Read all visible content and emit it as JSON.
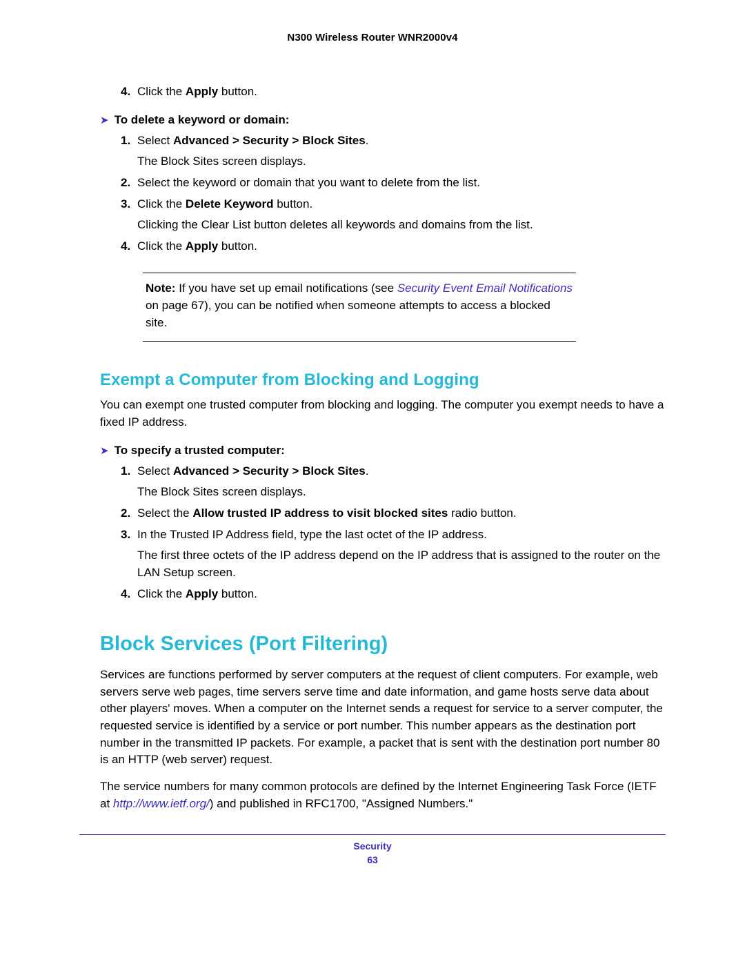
{
  "header": {
    "title": "N300 Wireless Router WNR2000v4"
  },
  "intro_step": {
    "num": "4.",
    "pre": "Click the ",
    "bold": "Apply",
    "post": " button."
  },
  "delete_proc": {
    "arrow": "➤",
    "label": "To delete a keyword or domain:",
    "steps": [
      {
        "num": "1.",
        "pre": "Select ",
        "bold": "Advanced > Security > Block Sites",
        "post": ".",
        "sub": "The Block Sites screen displays."
      },
      {
        "num": "2.",
        "text": "Select the keyword or domain that you want to delete from the list."
      },
      {
        "num": "3.",
        "pre": "Click the ",
        "bold": "Delete Keyword",
        "post": " button.",
        "sub": "Clicking the Clear List button deletes all keywords and domains from the list."
      },
      {
        "num": "4.",
        "pre": "Click the ",
        "bold": "Apply",
        "post": " button."
      }
    ]
  },
  "note": {
    "label": "Note:",
    "part1": "If you have set up email notifications (see ",
    "link": "Security Event Email Notifications",
    "part2": " on page 67), you can be notified when someone attempts to access a blocked site."
  },
  "exempt": {
    "heading": "Exempt a Computer from Blocking and Logging",
    "intro": "You can exempt one trusted computer from blocking and logging. The computer you exempt needs to have a fixed IP address."
  },
  "trusted_proc": {
    "arrow": "➤",
    "label": "To specify a trusted computer:",
    "steps": [
      {
        "num": "1.",
        "pre": "Select ",
        "bold": "Advanced > Security > Block Sites",
        "post": ".",
        "sub": "The Block Sites screen displays."
      },
      {
        "num": "2.",
        "pre": "Select the ",
        "bold": "Allow trusted IP address to visit blocked sites",
        "post": " radio button."
      },
      {
        "num": "3.",
        "text": "In the Trusted IP Address field, type the last octet of the IP address.",
        "sub": "The first three octets of the IP address depend on the IP address that is assigned to the router on the LAN Setup screen."
      },
      {
        "num": "4.",
        "pre": "Click the ",
        "bold": "Apply",
        "post": " button."
      }
    ]
  },
  "block_services": {
    "heading": "Block Services (Port Filtering)",
    "para1": "Services are functions performed by server computers at the request of client computers. For example, web servers serve web pages, time servers serve time and date information, and game hosts serve data about other players' moves. When a computer on the Internet sends a request for service to a server computer, the requested service is identified by a service or port number. This number appears as the destination port number in the transmitted IP packets. For example, a packet that is sent with the destination port number 80 is an HTTP (web server) request.",
    "para2_pre": "The service numbers for many common protocols are defined by the Internet Engineering Task Force (IETF at ",
    "para2_link": "http://www.ietf.org/",
    "para2_post": ") and published in RFC1700, \"Assigned Numbers.\""
  },
  "footer": {
    "section": "Security",
    "page": "63"
  }
}
